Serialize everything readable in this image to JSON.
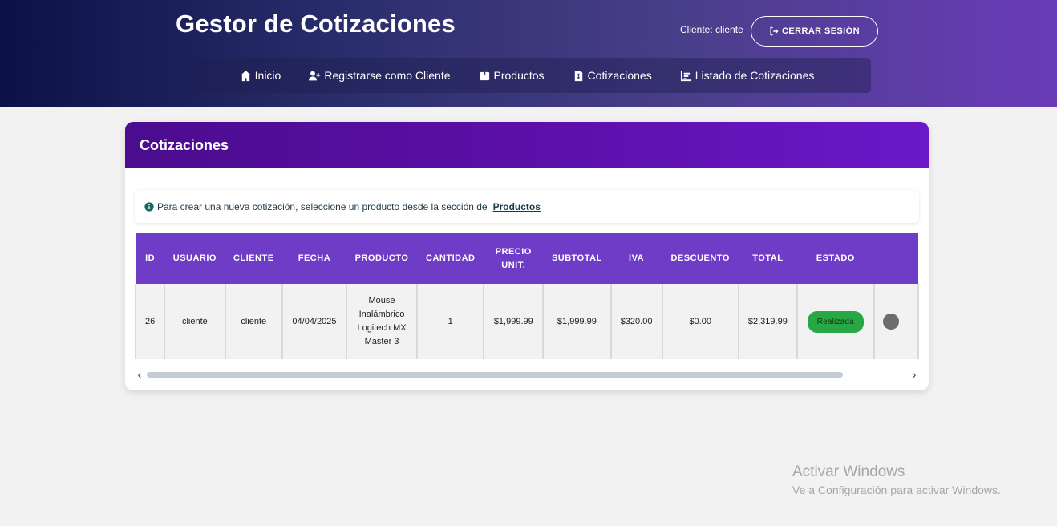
{
  "header": {
    "title": "Gestor de Cotizaciones",
    "client_label": "Cliente: cliente",
    "logout_label": "CERRAR SESIÓN"
  },
  "nav": {
    "items": [
      {
        "label": "Inicio",
        "icon": "home-icon"
      },
      {
        "label": "Registrarse como Cliente",
        "icon": "user-plus-icon"
      },
      {
        "label": "Productos",
        "icon": "box-icon"
      },
      {
        "label": "Cotizaciones",
        "icon": "file-invoice-icon"
      },
      {
        "label": "Listado de Cotizaciones",
        "icon": "chart-bar-icon"
      }
    ]
  },
  "card": {
    "title": "Cotizaciones",
    "info_text": "Para crear una nueva cotización, seleccione un producto desde la sección de",
    "info_link": "Productos"
  },
  "table": {
    "headers": [
      "ID",
      "USUARIO",
      "CLIENTE",
      "FECHA",
      "PRODUCTO",
      "CANTIDAD",
      "PRECIO UNIT.",
      "SUBTOTAL",
      "IVA",
      "DESCUENTO",
      "TOTAL",
      "ESTADO",
      ""
    ],
    "rows": [
      {
        "id": "26",
        "usuario": "cliente",
        "cliente": "cliente",
        "fecha": "04/04/2025",
        "producto": "Mouse Inalámbrico Logitech MX Master 3",
        "cantidad": "1",
        "precio_unit": "$1,999.99",
        "subtotal": "$1,999.99",
        "iva": "$320.00",
        "descuento": "$0.00",
        "total": "$2,319.99",
        "estado": "Realizada"
      }
    ]
  },
  "colors": {
    "header_gradient_start": "#0b1247",
    "header_gradient_end": "#6a3bb8",
    "card_header": "#5c0fa8",
    "table_header": "#6e3cc6",
    "status_realizada": "#28a745"
  },
  "watermark": {
    "title": "Activar Windows",
    "subtitle": "Ve a Configuración para activar Windows."
  }
}
